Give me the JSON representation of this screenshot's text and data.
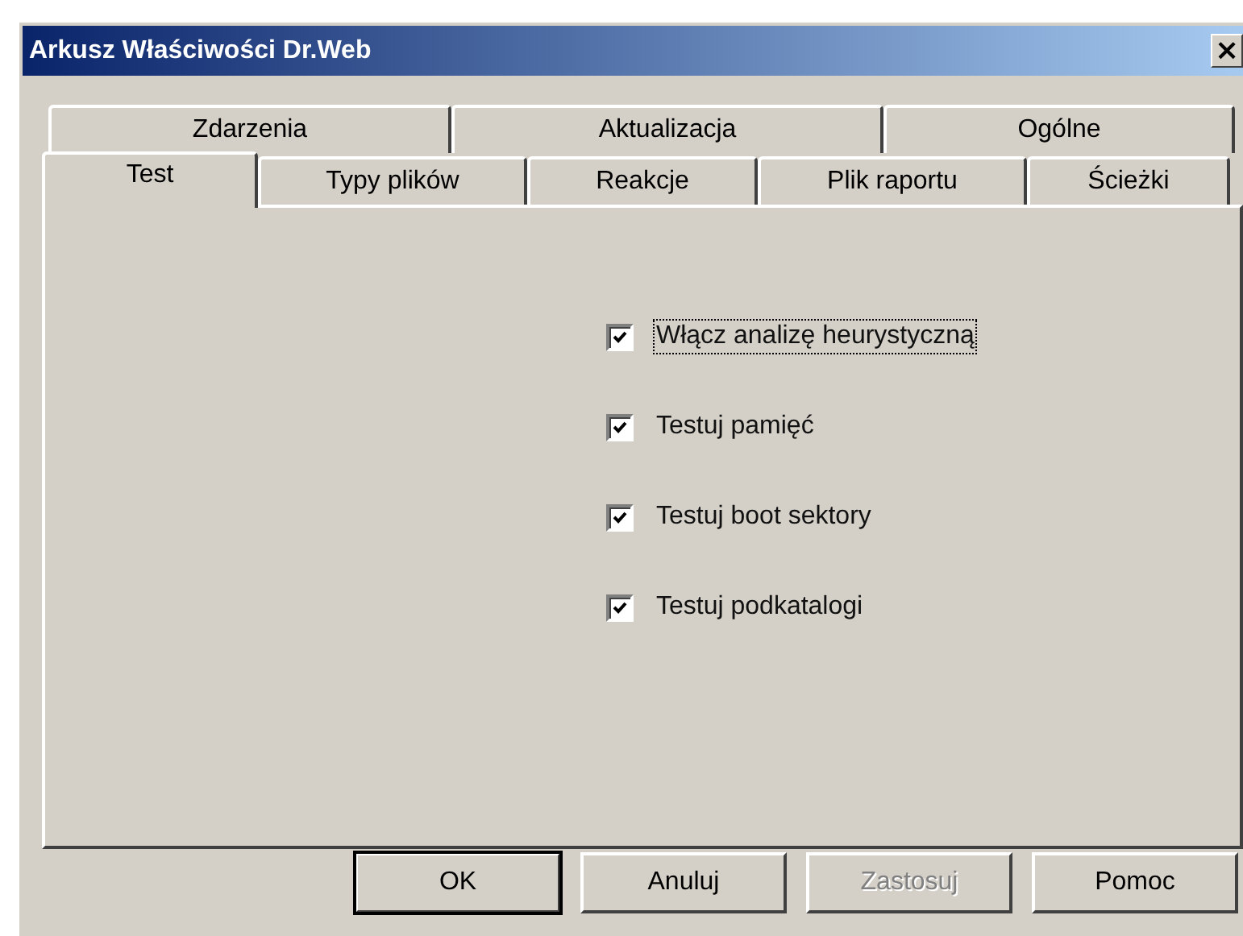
{
  "window": {
    "title": "Arkusz Właściwości Dr.Web",
    "close_label": "×"
  },
  "tab_rows": [
    [
      {
        "label": "Zdarzenia",
        "selected": false
      },
      {
        "label": "Aktualizacja",
        "selected": false
      },
      {
        "label": "Ogólne",
        "selected": false
      }
    ],
    [
      {
        "label": "Test",
        "selected": true
      },
      {
        "label": "Typy plików",
        "selected": false
      },
      {
        "label": "Reakcje",
        "selected": false
      },
      {
        "label": "Plik raportu",
        "selected": false
      },
      {
        "label": "Ścieżki",
        "selected": false
      }
    ]
  ],
  "options": [
    {
      "label": "Włącz analizę heurystyczną",
      "checked": true,
      "focused": true
    },
    {
      "label": "Testuj pamięć",
      "checked": true,
      "focused": false
    },
    {
      "label": "Testuj boot sektory",
      "checked": true,
      "focused": false
    },
    {
      "label": "Testuj podkatalogi",
      "checked": true,
      "focused": false
    }
  ],
  "buttons": [
    {
      "label": "OK",
      "default": true,
      "disabled": false
    },
    {
      "label": "Anuluj",
      "default": false,
      "disabled": false
    },
    {
      "label": "Zastosuj",
      "default": false,
      "disabled": true
    },
    {
      "label": "Pomoc",
      "default": false,
      "disabled": false
    }
  ]
}
